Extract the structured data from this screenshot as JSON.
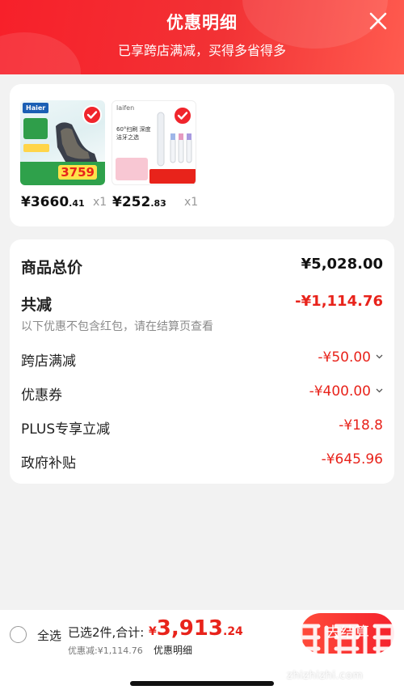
{
  "header": {
    "title": "优惠明细",
    "subtitle": "已享跨店满减，买得多省得多"
  },
  "products": [
    {
      "brand": "Haier",
      "name": "massage-chair",
      "promo_price": "3759",
      "price_int": "¥3660",
      "price_dec": ".41",
      "qty": "x1"
    },
    {
      "brand": "laifen",
      "name": "electric-toothbrush",
      "promo_text": "60°扫刷 深度洁牙之选",
      "price_int": "¥252",
      "price_dec": ".83",
      "qty": "x1"
    }
  ],
  "details": {
    "total_label": "商品总价",
    "total_value": "¥5,028.00",
    "reduce_label": "共减",
    "reduce_value": "-¥1,114.76",
    "note": "以下优惠不包含红包，请在结算页查看",
    "items": [
      {
        "label": "跨店满减",
        "value": "-¥50.00",
        "expandable": true
      },
      {
        "label": "优惠券",
        "value": "-¥400.00",
        "expandable": true
      },
      {
        "label": "PLUS专享立减",
        "value": "-¥18.8",
        "expandable": false
      },
      {
        "label": "政府补贴",
        "value": "-¥645.96",
        "expandable": false
      }
    ]
  },
  "footer": {
    "select_all": "全选",
    "selected_info": "已选2件,合计:",
    "total_symbol": "¥",
    "total_int": "3,913",
    "total_dec": ".24",
    "saved": "优惠减:¥1,114.76",
    "detail_link": "优惠明细",
    "checkout": "去结算"
  },
  "watermark": {
    "text": "值值值",
    "url": "zhizhizhi.com"
  },
  "colors": {
    "accent": "#f0252c",
    "price_red": "#e8231b",
    "header_start": "#f7202a"
  }
}
